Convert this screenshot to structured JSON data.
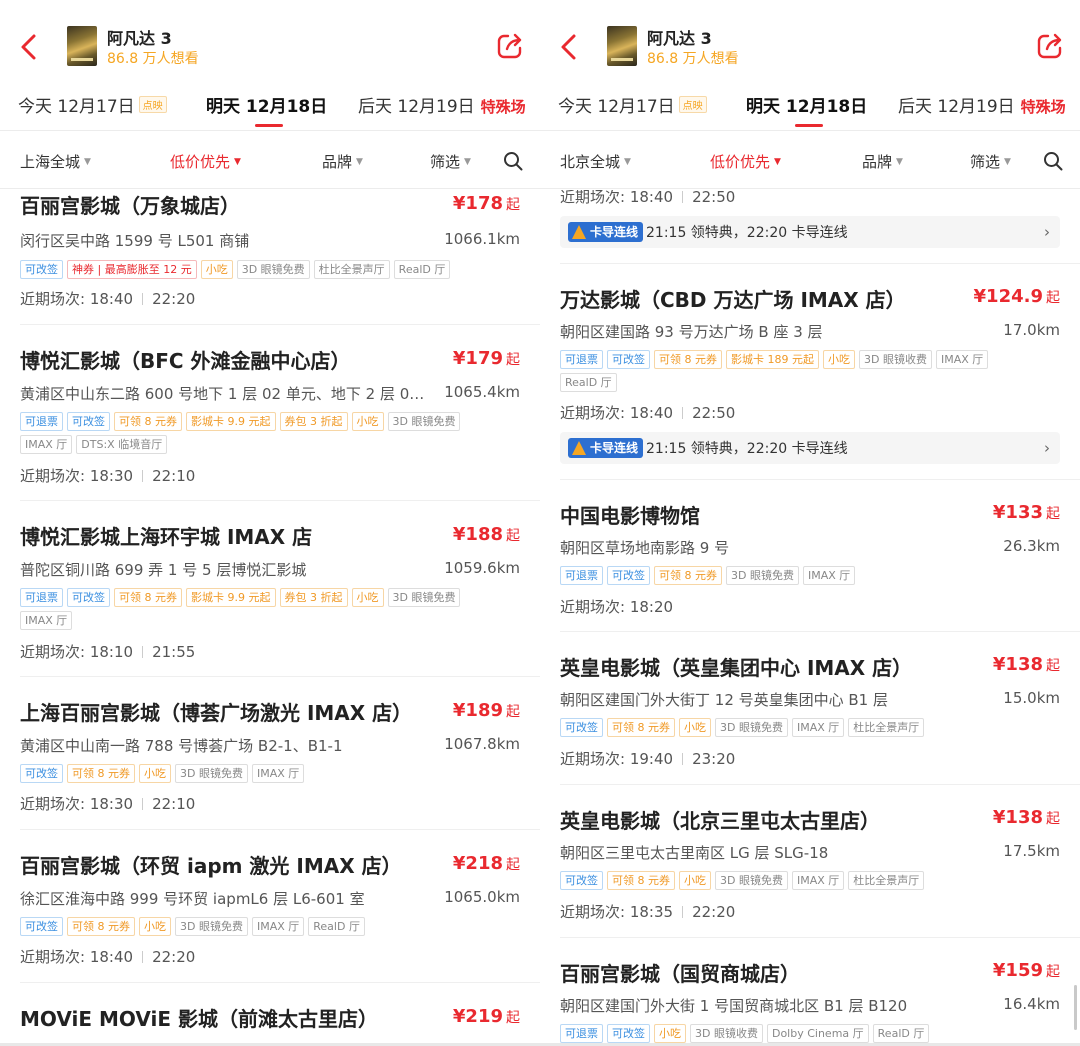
{
  "left": {
    "movie_title": "阿凡达 3",
    "want_count": "86.8 万人想看",
    "dates": [
      {
        "label": "今天 12月17日",
        "badge": "点映"
      },
      {
        "label": "明天 12月18日"
      },
      {
        "label": "后天 12月19日",
        "special": "特殊场"
      }
    ],
    "filters": {
      "city": "上海全城",
      "sort": "低价优先",
      "brand": "品牌",
      "filter": "筛选"
    },
    "cinemas": [
      {
        "name": "百丽宫影城（万象城店）",
        "price": "¥178",
        "qi": "起",
        "address": "闵行区吴中路 1599 号 L501 商铺",
        "distance": "1066.1km",
        "tags": [
          {
            "t": "可改签",
            "c": "blue"
          },
          {
            "t": "神券 | 最高膨胀至 12 元",
            "c": "red"
          },
          {
            "t": "小吃",
            "c": "orange"
          },
          {
            "t": "3D 眼镜免费",
            "c": "gray"
          },
          {
            "t": "杜比全景声厅",
            "c": "gray"
          },
          {
            "t": "RealD 厅",
            "c": "gray"
          }
        ],
        "times_label": "近期场次:",
        "times": [
          "18:40",
          "22:20"
        ]
      },
      {
        "name": "博悦汇影城（BFC 外滩金融中心店）",
        "price": "¥179",
        "qi": "起",
        "address": "黄浦区中山东二路 600 号地下 1 层 02 单元、地下 2 层 0…",
        "distance": "1065.4km",
        "tags": [
          {
            "t": "可退票",
            "c": "blue"
          },
          {
            "t": "可改签",
            "c": "blue"
          },
          {
            "t": "可领 8 元券",
            "c": "orange"
          },
          {
            "t": "影城卡 9.9 元起",
            "c": "orange"
          },
          {
            "t": "券包 3 折起",
            "c": "orange"
          },
          {
            "t": "小吃",
            "c": "orange"
          },
          {
            "t": "3D 眼镜免费",
            "c": "gray"
          },
          {
            "t": "IMAX 厅",
            "c": "gray"
          },
          {
            "t": "DTS:X 临境音厅",
            "c": "gray"
          }
        ],
        "times_label": "近期场次:",
        "times": [
          "18:30",
          "22:10"
        ]
      },
      {
        "name": "博悦汇影城上海环宇城 IMAX 店",
        "price": "¥188",
        "qi": "起",
        "address": "普陀区铜川路 699 弄 1 号 5 层博悦汇影城",
        "distance": "1059.6km",
        "tags": [
          {
            "t": "可退票",
            "c": "blue"
          },
          {
            "t": "可改签",
            "c": "blue"
          },
          {
            "t": "可领 8 元券",
            "c": "orange"
          },
          {
            "t": "影城卡 9.9 元起",
            "c": "orange"
          },
          {
            "t": "券包 3 折起",
            "c": "orange"
          },
          {
            "t": "小吃",
            "c": "orange"
          },
          {
            "t": "3D 眼镜免费",
            "c": "gray"
          },
          {
            "t": "IMAX 厅",
            "c": "gray"
          }
        ],
        "times_label": "近期场次:",
        "times": [
          "18:10",
          "21:55"
        ]
      },
      {
        "name": "上海百丽宫影城（博荟广场激光 IMAX 店）",
        "price": "¥189",
        "qi": "起",
        "address": "黄浦区中山南一路 788 号博荟广场 B2-1、B1-1",
        "distance": "1067.8km",
        "tags": [
          {
            "t": "可改签",
            "c": "blue"
          },
          {
            "t": "可领 8 元券",
            "c": "orange"
          },
          {
            "t": "小吃",
            "c": "orange"
          },
          {
            "t": "3D 眼镜免费",
            "c": "gray"
          },
          {
            "t": "IMAX 厅",
            "c": "gray"
          }
        ],
        "times_label": "近期场次:",
        "times": [
          "18:30",
          "22:10"
        ]
      },
      {
        "name": "百丽宫影城（环贸 iapm 激光 IMAX 店）",
        "price": "¥218",
        "qi": "起",
        "address": "徐汇区淮海中路 999 号环贸 iapmL6 层 L6-601 室",
        "distance": "1065.0km",
        "tags": [
          {
            "t": "可改签",
            "c": "blue"
          },
          {
            "t": "可领 8 元券",
            "c": "orange"
          },
          {
            "t": "小吃",
            "c": "orange"
          },
          {
            "t": "3D 眼镜免费",
            "c": "gray"
          },
          {
            "t": "IMAX 厅",
            "c": "gray"
          },
          {
            "t": "RealD 厅",
            "c": "gray"
          }
        ],
        "times_label": "近期场次:",
        "times": [
          "18:40",
          "22:20"
        ]
      },
      {
        "name": "MOViE MOViE 影城（前滩太古里店）",
        "price": "¥219",
        "qi": "起"
      }
    ]
  },
  "right": {
    "movie_title": "阿凡达 3",
    "want_count": "86.8 万人想看",
    "dates": [
      {
        "label": "今天 12月17日",
        "badge": "点映"
      },
      {
        "label": "明天 12月18日"
      },
      {
        "label": "后天 12月19日",
        "special": "特殊场"
      }
    ],
    "filters": {
      "city": "北京全城",
      "sort": "低价优先",
      "brand": "品牌",
      "filter": "筛选"
    },
    "top_partial": {
      "times_label": "近期场次:",
      "times": [
        "18:40",
        "22:50"
      ],
      "promo_badge": "卡导连线",
      "promo_text": "21:15 领特典，22:20 卡导连线"
    },
    "cinemas": [
      {
        "name": "万达影城（CBD 万达广场 IMAX 店）",
        "price": "¥124.9",
        "qi": "起",
        "address": "朝阳区建国路 93 号万达广场 B 座 3 层",
        "distance": "17.0km",
        "tags": [
          {
            "t": "可退票",
            "c": "blue"
          },
          {
            "t": "可改签",
            "c": "blue"
          },
          {
            "t": "可领 8 元券",
            "c": "orange"
          },
          {
            "t": "影城卡 189 元起",
            "c": "orange"
          },
          {
            "t": "小吃",
            "c": "orange"
          },
          {
            "t": "3D 眼镜收费",
            "c": "gray"
          },
          {
            "t": "IMAX 厅",
            "c": "gray"
          },
          {
            "t": "RealD 厅",
            "c": "gray"
          }
        ],
        "times_label": "近期场次:",
        "times": [
          "18:40",
          "22:50"
        ],
        "promo_badge": "卡导连线",
        "promo_text": "21:15 领特典，22:20 卡导连线"
      },
      {
        "name": "中国电影博物馆",
        "price": "¥133",
        "qi": "起",
        "address": "朝阳区草场地南影路 9 号",
        "distance": "26.3km",
        "tags": [
          {
            "t": "可退票",
            "c": "blue"
          },
          {
            "t": "可改签",
            "c": "blue"
          },
          {
            "t": "可领 8 元券",
            "c": "orange"
          },
          {
            "t": "3D 眼镜免费",
            "c": "gray"
          },
          {
            "t": "IMAX 厅",
            "c": "gray"
          }
        ],
        "times_label": "近期场次:",
        "times": [
          "18:20"
        ]
      },
      {
        "name": "英皇电影城（英皇集团中心 IMAX 店）",
        "price": "¥138",
        "qi": "起",
        "address": "朝阳区建国门外大街丁 12 号英皇集团中心 B1 层",
        "distance": "15.0km",
        "tags": [
          {
            "t": "可改签",
            "c": "blue"
          },
          {
            "t": "可领 8 元券",
            "c": "orange"
          },
          {
            "t": "小吃",
            "c": "orange"
          },
          {
            "t": "3D 眼镜免费",
            "c": "gray"
          },
          {
            "t": "IMAX 厅",
            "c": "gray"
          },
          {
            "t": "杜比全景声厅",
            "c": "gray"
          }
        ],
        "times_label": "近期场次:",
        "times": [
          "19:40",
          "23:20"
        ]
      },
      {
        "name": "英皇电影城（北京三里屯太古里店）",
        "price": "¥138",
        "qi": "起",
        "address": "朝阳区三里屯太古里南区 LG 层 SLG-18",
        "distance": "17.5km",
        "tags": [
          {
            "t": "可改签",
            "c": "blue"
          },
          {
            "t": "可领 8 元券",
            "c": "orange"
          },
          {
            "t": "小吃",
            "c": "orange"
          },
          {
            "t": "3D 眼镜免费",
            "c": "gray"
          },
          {
            "t": "IMAX 厅",
            "c": "gray"
          },
          {
            "t": "杜比全景声厅",
            "c": "gray"
          }
        ],
        "times_label": "近期场次:",
        "times": [
          "18:35",
          "22:20"
        ]
      },
      {
        "name": "百丽宫影城（国贸商城店）",
        "price": "¥159",
        "qi": "起",
        "address": "朝阳区建国门外大街 1 号国贸商城北区 B1 层 B120",
        "distance": "16.4km",
        "tags": [
          {
            "t": "可退票",
            "c": "blue"
          },
          {
            "t": "可改签",
            "c": "blue"
          },
          {
            "t": "小吃",
            "c": "orange"
          },
          {
            "t": "3D 眼镜收费",
            "c": "gray"
          },
          {
            "t": "Dolby Cinema 厅",
            "c": "gray"
          },
          {
            "t": "RealD 厅",
            "c": "gray"
          }
        ]
      }
    ]
  },
  "colors": {
    "accent_red": "#e9292f",
    "orange": "#f5a623",
    "blue": "#3b8fe0"
  },
  "icons": {
    "back": "chevron-left-icon",
    "share": "share-icon",
    "search": "search-icon"
  }
}
